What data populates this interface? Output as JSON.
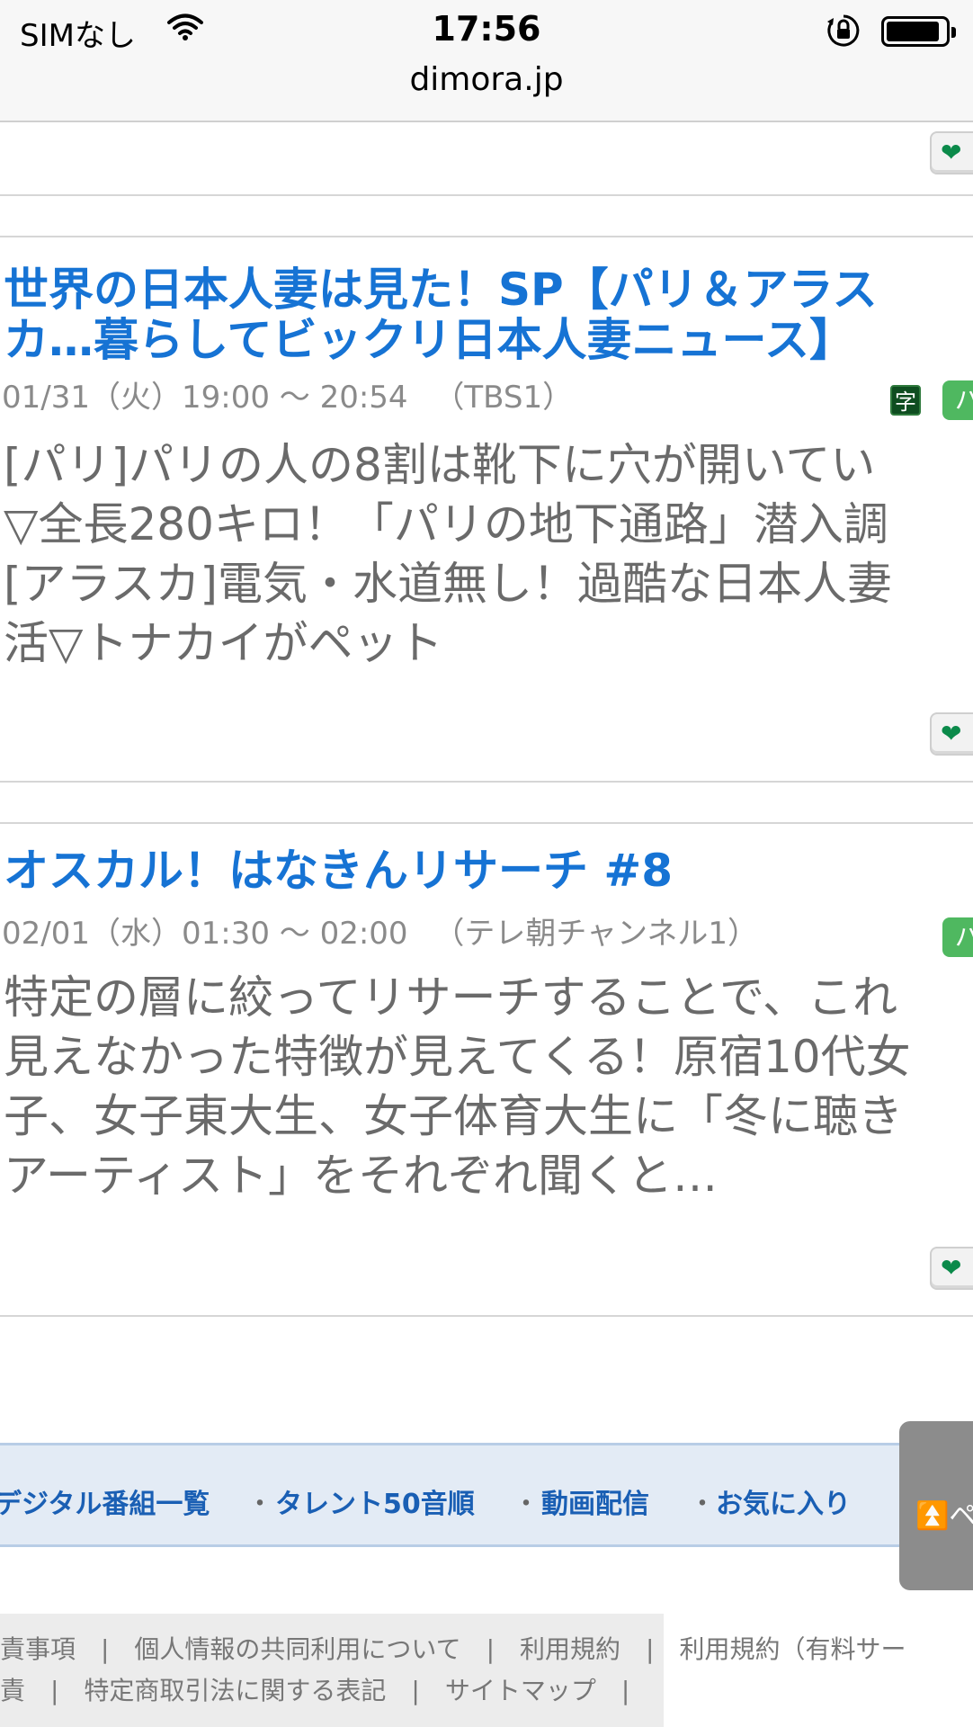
{
  "status_bar": {
    "carrier": "SIMなし",
    "time": "17:56",
    "url": "dimora.jp"
  },
  "programs": [
    {
      "title_line1": "世界の日本人妻は見た！SP【パリ＆アラス",
      "title_line2": "カ…暮らしてビックリ日本人妻ニュース】",
      "datetime": "01/31（火）19:00 ～ 20:54",
      "channel": "（TBS1）",
      "badge_subtitle": "字",
      "badge_green": "パ",
      "desc_lines": [
        "[パリ]パリの人の8割は靴下に穴が開いてい",
        "▽全長280キロ！「パリの地下通路」潜入調",
        "[アラスカ]電気・水道無し！過酷な日本人妻",
        "活▽トナカイがペット"
      ]
    },
    {
      "title_line1": "オスカル！はなきんリサーチ #8",
      "datetime": "02/01（水）01:30 ～ 02:00",
      "channel": "（テレ朝チャンネル1）",
      "badge_green": "パ",
      "desc_lines": [
        "特定の層に絞ってリサーチすることで、これ",
        "見えなかった特徴が見えてくる！原宿10代女",
        "子、女子東大生、女子体育大生に「冬に聴き",
        "アーティスト」をそれぞれ聞くと…"
      ]
    }
  ],
  "nav": {
    "items": [
      "デジタル番組一覧",
      "タレント50音順",
      "動画配信",
      "お気に入り"
    ],
    "separator": "・",
    "page_top": "ペ"
  },
  "footer": {
    "line1": "責事項　|　個人情報の共同利用について　|　利用規約　|　利用規約（有料サー",
    "line2": "責　|　特定商取引法に関する表記　|　サイトマップ　|"
  },
  "colors": {
    "link_blue": "#1673d4",
    "fav_heart": "#0b8a4a",
    "badge_green": "#4fb860"
  }
}
